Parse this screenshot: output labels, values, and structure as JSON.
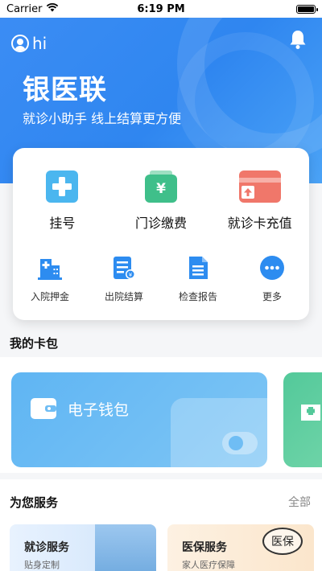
{
  "status_bar": {
    "carrier": "Carrier",
    "time": "6:19 PM"
  },
  "header": {
    "greeting": "hi",
    "app_title": "银医联",
    "slogan": "就诊小助手 线上结算更方便"
  },
  "quick_actions_primary": [
    {
      "label": "挂号",
      "icon": "plus-icon",
      "color": "#4bb6ef"
    },
    {
      "label": "门诊缴费",
      "icon": "yen-wallet-icon",
      "color": "#3fbf8a"
    },
    {
      "label": "就诊卡充值",
      "icon": "card-topup-icon",
      "color": "#f0776a"
    }
  ],
  "quick_actions_secondary": [
    {
      "label": "入院押金",
      "icon": "hospital-building-icon"
    },
    {
      "label": "出院结算",
      "icon": "settlement-doc-icon"
    },
    {
      "label": "检查报告",
      "icon": "report-doc-icon"
    },
    {
      "label": "更多",
      "icon": "more-icon"
    }
  ],
  "card_pack": {
    "title": "我的卡包",
    "wallet_label": "电子钱包"
  },
  "services": {
    "title": "为您服务",
    "more_label": "全部",
    "items": [
      {
        "title": "就诊服务",
        "subtitle": "贴身定制"
      },
      {
        "title": "医保服务",
        "subtitle": "家人医疗保障",
        "stamp": "医保"
      }
    ]
  },
  "colors": {
    "primary_blue": "#2f86f0",
    "wallet_blue": "#5fb5f3",
    "green_card": "#53c99a"
  }
}
